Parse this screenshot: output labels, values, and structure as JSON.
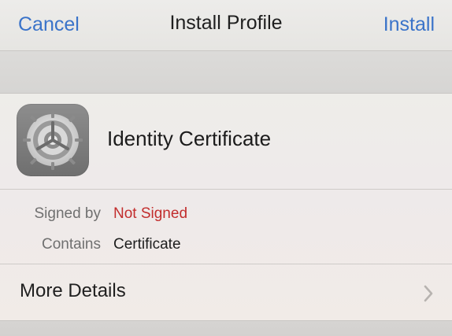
{
  "navbar": {
    "left_label": "Cancel",
    "title": "Install Profile",
    "right_label": "Install"
  },
  "profile": {
    "name": "Identity Certificate",
    "icon": "settings-gear-icon"
  },
  "details": {
    "signed_by_label": "Signed by",
    "signed_by_value": "Not Signed",
    "contains_label": "Contains",
    "contains_value": "Certificate"
  },
  "more": {
    "label": "More Details"
  },
  "colors": {
    "link_blue": "#3a73c9",
    "danger_red": "#c22d2d",
    "muted_gray": "#707070"
  }
}
